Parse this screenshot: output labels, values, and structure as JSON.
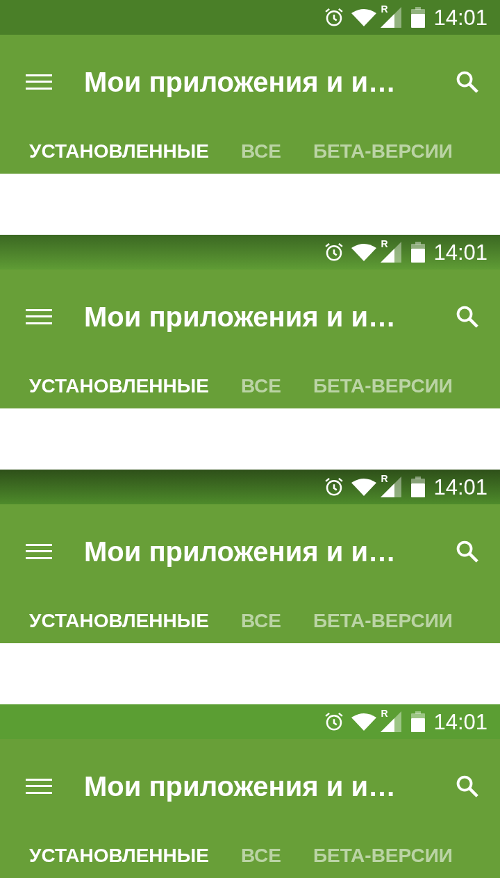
{
  "frames": [
    {
      "status_bar": {
        "kind": "solid-dark",
        "roaming": "R",
        "time": "14:01"
      },
      "app_bar": {
        "title": "Мои приложения и и…"
      },
      "tabs": [
        {
          "label": "УСТАНОВЛЕННЫЕ",
          "selected": true
        },
        {
          "label": "ВСЕ",
          "selected": false
        },
        {
          "label": "БЕТА-ВЕРСИИ",
          "selected": false
        }
      ]
    },
    {
      "status_bar": {
        "kind": "fade",
        "roaming": "R",
        "time": "14:01"
      },
      "app_bar": {
        "title": "Мои приложения и и…"
      },
      "tabs": [
        {
          "label": "УСТАНОВЛЕННЫЕ",
          "selected": true
        },
        {
          "label": "ВСЕ",
          "selected": false
        },
        {
          "label": "БЕТА-ВЕРСИИ",
          "selected": false
        }
      ]
    },
    {
      "status_bar": {
        "kind": "dark-fade",
        "roaming": "R",
        "time": "14:01"
      },
      "app_bar": {
        "title": "Мои приложения и и…"
      },
      "tabs": [
        {
          "label": "УСТАНОВЛЕННЫЕ",
          "selected": true
        },
        {
          "label": "ВСЕ",
          "selected": false
        },
        {
          "label": "БЕТА-ВЕРСИИ",
          "selected": false
        }
      ]
    },
    {
      "status_bar": {
        "kind": "bright",
        "roaming": "R",
        "time": "14:01"
      },
      "app_bar": {
        "title": "Мои приложения и и…"
      },
      "tabs": [
        {
          "label": "УСТАНОВЛЕННЫЕ",
          "selected": true
        },
        {
          "label": "ВСЕ",
          "selected": false
        },
        {
          "label": "БЕТА-ВЕРСИИ",
          "selected": false
        }
      ]
    }
  ]
}
